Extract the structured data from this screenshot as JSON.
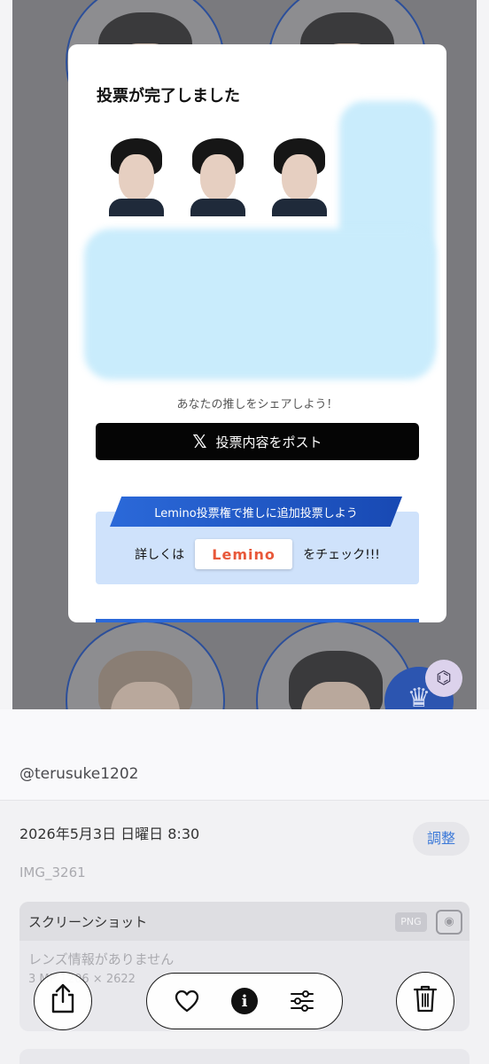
{
  "screenshot": {
    "modal": {
      "title": "投票が完了しました",
      "share_text": "あなたの推しをシェアしよう！",
      "post_button_label": "投票内容をポスト",
      "post_button_icon": "x-logo-icon",
      "lemino_banner": "Lemino投票権で推しに追加投票しよう",
      "lemino_prefix": "詳しくは",
      "lemino_logo": "Lemino",
      "lemino_suffix": "をチェック!!!"
    },
    "lens_button_icon": "visual-lookup-icon",
    "crown_icon": "crown-icon"
  },
  "info": {
    "caption": "@terusuke1202",
    "datetime": "2026年5月3日 日曜日 8:30",
    "adjust_label": "調整",
    "filename": "IMG_3261",
    "meta": {
      "type": "スクリーンショット",
      "format_badge": "PNG",
      "no_lens": "レンズ情報がありません",
      "dimensions": "3 MP  1206 × 2622"
    }
  },
  "toolbar": {
    "share_icon": "share-icon",
    "favorite_icon": "heart-icon",
    "info_icon": "info-icon",
    "adjust_icon": "sliders-icon",
    "delete_icon": "trash-icon"
  },
  "colors": {
    "accent_blue": "#2b69d9",
    "lemino_orange": "#e8583a",
    "adjust_text": "#3a78d8"
  }
}
